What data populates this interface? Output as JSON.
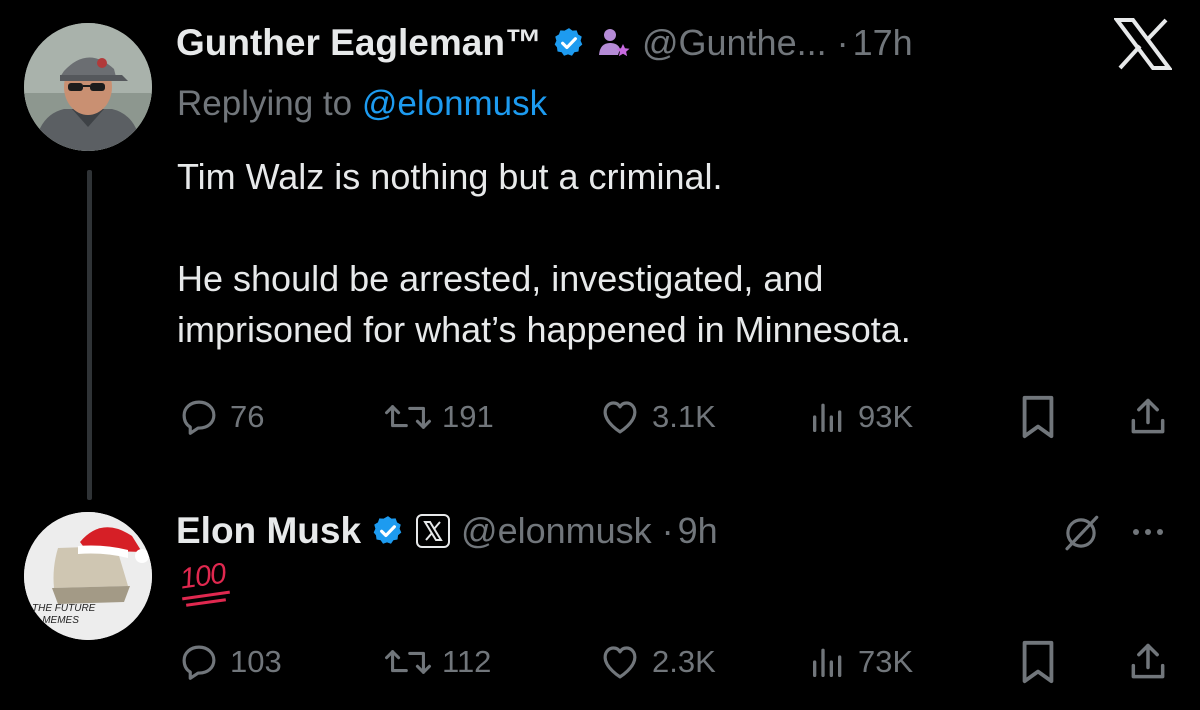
{
  "tweet1": {
    "author_name": "Gunther Eagleman™",
    "handle": "@Gunthe...",
    "separator": "·",
    "time": "17h",
    "replying_prefix": "Replying to ",
    "replying_to": "@elonmusk",
    "line1": "Tim Walz is nothing but a criminal.",
    "line2": "He should be arrested, investigated, and",
    "line3": "imprisoned for what’s happened in Minnesota.",
    "replies": "76",
    "reposts": "191",
    "likes": "3.1K",
    "views": "93K"
  },
  "tweet2": {
    "author_name": "Elon Musk",
    "handle": "@elonmusk",
    "separator": "·",
    "time": "9h",
    "emoji_text": "100",
    "replies": "103",
    "reposts": "112",
    "likes": "2.3K",
    "views": "73K",
    "avatar_text_line1": "THE FUTURE",
    "avatar_text_line2": "IS MEMES"
  },
  "colors": {
    "background": "#000000",
    "text": "#e7e9ea",
    "muted": "#71767b",
    "link": "#1d9bf0",
    "emoji": "#e0284f"
  },
  "icons": [
    "x-logo-icon",
    "verified-badge-icon",
    "affiliate-badge-icon",
    "x-affiliate-badge-icon",
    "reply-icon",
    "repost-icon",
    "like-icon",
    "views-icon",
    "bookmark-icon",
    "share-icon",
    "grok-icon",
    "more-icon"
  ]
}
